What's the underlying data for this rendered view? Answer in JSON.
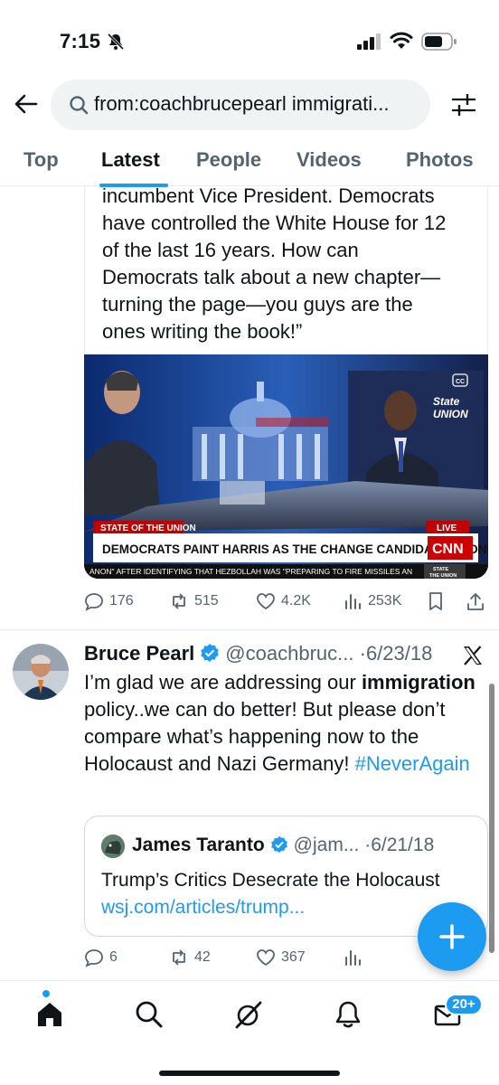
{
  "status_bar": {
    "time": "7:15"
  },
  "search": {
    "query": "from:coachbrucepearl immigrati..."
  },
  "tabs": [
    {
      "label": "Top"
    },
    {
      "label": "Latest"
    },
    {
      "label": "People"
    },
    {
      "label": "Videos"
    },
    {
      "label": "Photos"
    }
  ],
  "tweet1": {
    "text_lines": [
      "incumbent Vice President. Democrats",
      "have controlled the White House for 12",
      "of the last 16 years. How can",
      "Democrats talk about a new chapter—",
      "turning the page—you guys are the",
      "ones writing the book!”"
    ],
    "video": {
      "show_label": "STATE OF THE UNION",
      "live_label": "LIVE",
      "headline": "DEMOCRATS PAINT HARRIS AS THE CHANGE CANDIDATE AT DNC",
      "ticker": "ANON\" AFTER IDENTIFYING THAT HEZBOLLAH WAS \"PREPARING TO FIRE MISSILES AN",
      "network": "CNN",
      "corner_show_top": "State",
      "corner_show_bottom": "UNION",
      "cc": "CC",
      "bug_state": "STATE",
      "bug_union": "THE UNION"
    },
    "actions": {
      "replies": "176",
      "reposts": "515",
      "likes": "4.2K",
      "views": "253K"
    }
  },
  "tweet2": {
    "author": "Bruce Pearl",
    "handle": "@coachbruc...",
    "dot": "·",
    "date": "6/23/18",
    "text_before": "I’m glad we are addressing our ",
    "text_bold": "immigration",
    "text_after": " policy..we can do better! But please don’t compare what’s happening now to the Holocaust and Nazi Germany! ",
    "hashtag": "#NeverAgain",
    "quote": {
      "author": "James Taranto",
      "handle": "@jam...",
      "dot": "·",
      "date": "6/21/18",
      "text": "Trump’s Critics Desecrate the Holocaust ",
      "link": "wsj.com/articles/trump..."
    },
    "actions": {
      "replies": "6",
      "reposts": "42",
      "likes": "367"
    }
  },
  "bottom_nav": {
    "badge": "20+"
  },
  "colors": {
    "accent": "#1d9bf0",
    "text": "#0f1419",
    "muted": "#536471",
    "cnn_red": "#cc0000"
  }
}
